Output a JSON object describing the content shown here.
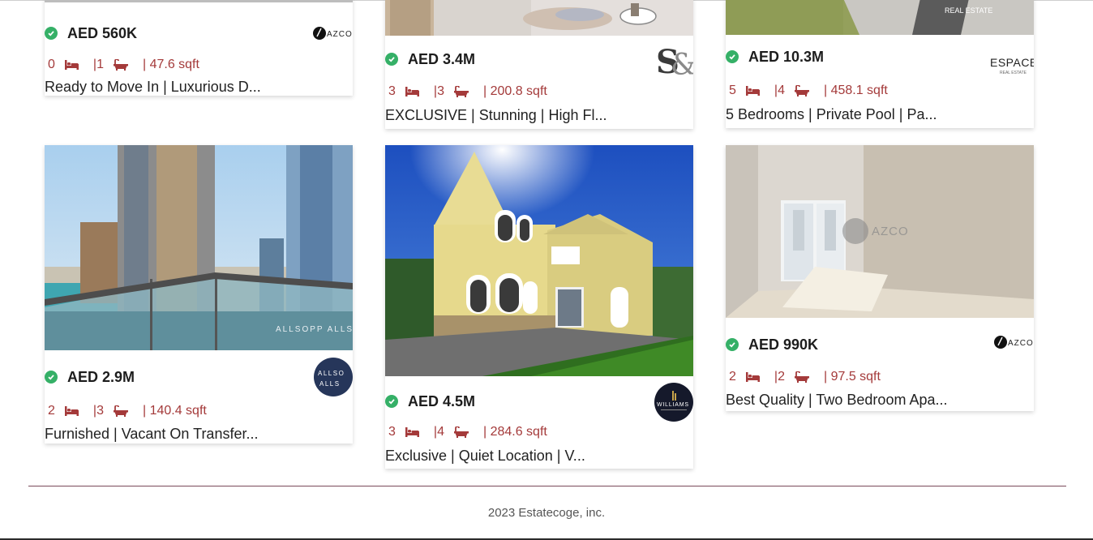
{
  "listings": [
    {
      "price": "AED 560K",
      "beds": "0",
      "baths": "|1",
      "area": "| 47.6 sqft",
      "title": "Ready to Move In | Luxurious D...",
      "agency_logo": "AZCO"
    },
    {
      "price": "AED 3.4M",
      "beds": "3",
      "baths": "|3",
      "area": "| 200.8 sqft",
      "title": "EXCLUSIVE | Stunning | High Fl...",
      "agency_logo": "S&"
    },
    {
      "price": "AED 10.3M",
      "beds": "5",
      "baths": "|4",
      "area": "| 458.1 sqft",
      "title": "5 Bedrooms | Private Pool | Pa...",
      "agency_logo": "ESPACE",
      "agency_logo_sub": "REAL ESTATE"
    },
    {
      "price": "AED 2.9M",
      "beds": "2",
      "baths": "|3",
      "area": "| 140.4 sqft",
      "title": "Furnished | Vacant On Transfer...",
      "agency_logo": "ALLSO ALLS",
      "watermark": "ALLSOPP ALLSOPP"
    },
    {
      "price": "AED 4.5M",
      "beds": "3",
      "baths": "|4",
      "area": "| 284.6 sqft",
      "title": "Exclusive | Quiet Location | V...",
      "agency_logo": "WILLIAMS"
    },
    {
      "price": "AED 990K",
      "beds": "2",
      "baths": "|2",
      "area": "| 97.5 sqft",
      "title": "Best Quality | Two Bedroom Apa...",
      "agency_logo": "AZCO",
      "watermark": "AZCO"
    }
  ],
  "top_photo_text": "REAL ESTATE",
  "footer": {
    "copyright": "2023 Estatecoge, inc."
  },
  "colors": {
    "accent": "#a43a3a",
    "verified": "#35b067",
    "footer_line": "#7a4a5a"
  },
  "icons": {
    "verified": "check-circle-icon",
    "beds": "bed-icon",
    "baths": "bathtub-icon",
    "area": "grid-icon"
  }
}
